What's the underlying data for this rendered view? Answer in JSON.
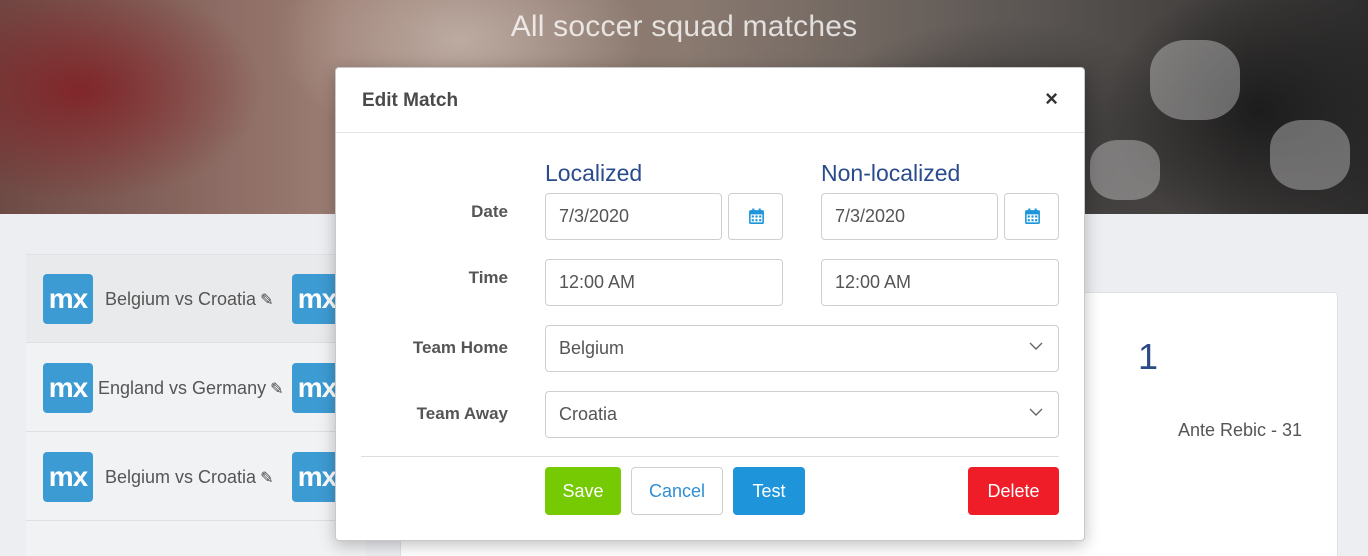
{
  "page": {
    "title": "All soccer squad matches"
  },
  "list": {
    "logo_text": "mx",
    "items": [
      {
        "label": "Belgium vs Croatia"
      },
      {
        "label": "England vs Germany"
      },
      {
        "label": "Belgium vs Croatia"
      }
    ]
  },
  "detail": {
    "score": "1",
    "scorer": "Ante Rebic - 31"
  },
  "modal": {
    "title": "Edit Match",
    "close_label": "×",
    "col_localized": "Localized",
    "col_nonlocalized": "Non-localized",
    "date_label": "Date",
    "time_label": "Time",
    "team_home_label": "Team Home",
    "team_away_label": "Team Away",
    "date_localized": "7/3/2020",
    "date_nonlocalized": "7/3/2020",
    "time_localized": "12:00 AM",
    "time_nonlocalized": "12:00 AM",
    "team_home_value": "Belgium",
    "team_away_value": "Croatia",
    "buttons": {
      "save": "Save",
      "cancel": "Cancel",
      "test": "Test",
      "delete": "Delete"
    }
  },
  "colors": {
    "accent_blue": "#1e95db",
    "save_green": "#76ca03",
    "delete_red": "#ee1d28",
    "heading_blue": "#2a4b8c",
    "mx_blue": "#3d9bd3"
  },
  "icons": {
    "calendar": "calendar-icon",
    "dropdown": "chevron-down-icon",
    "edit": "pencil-icon",
    "close": "close-icon"
  }
}
